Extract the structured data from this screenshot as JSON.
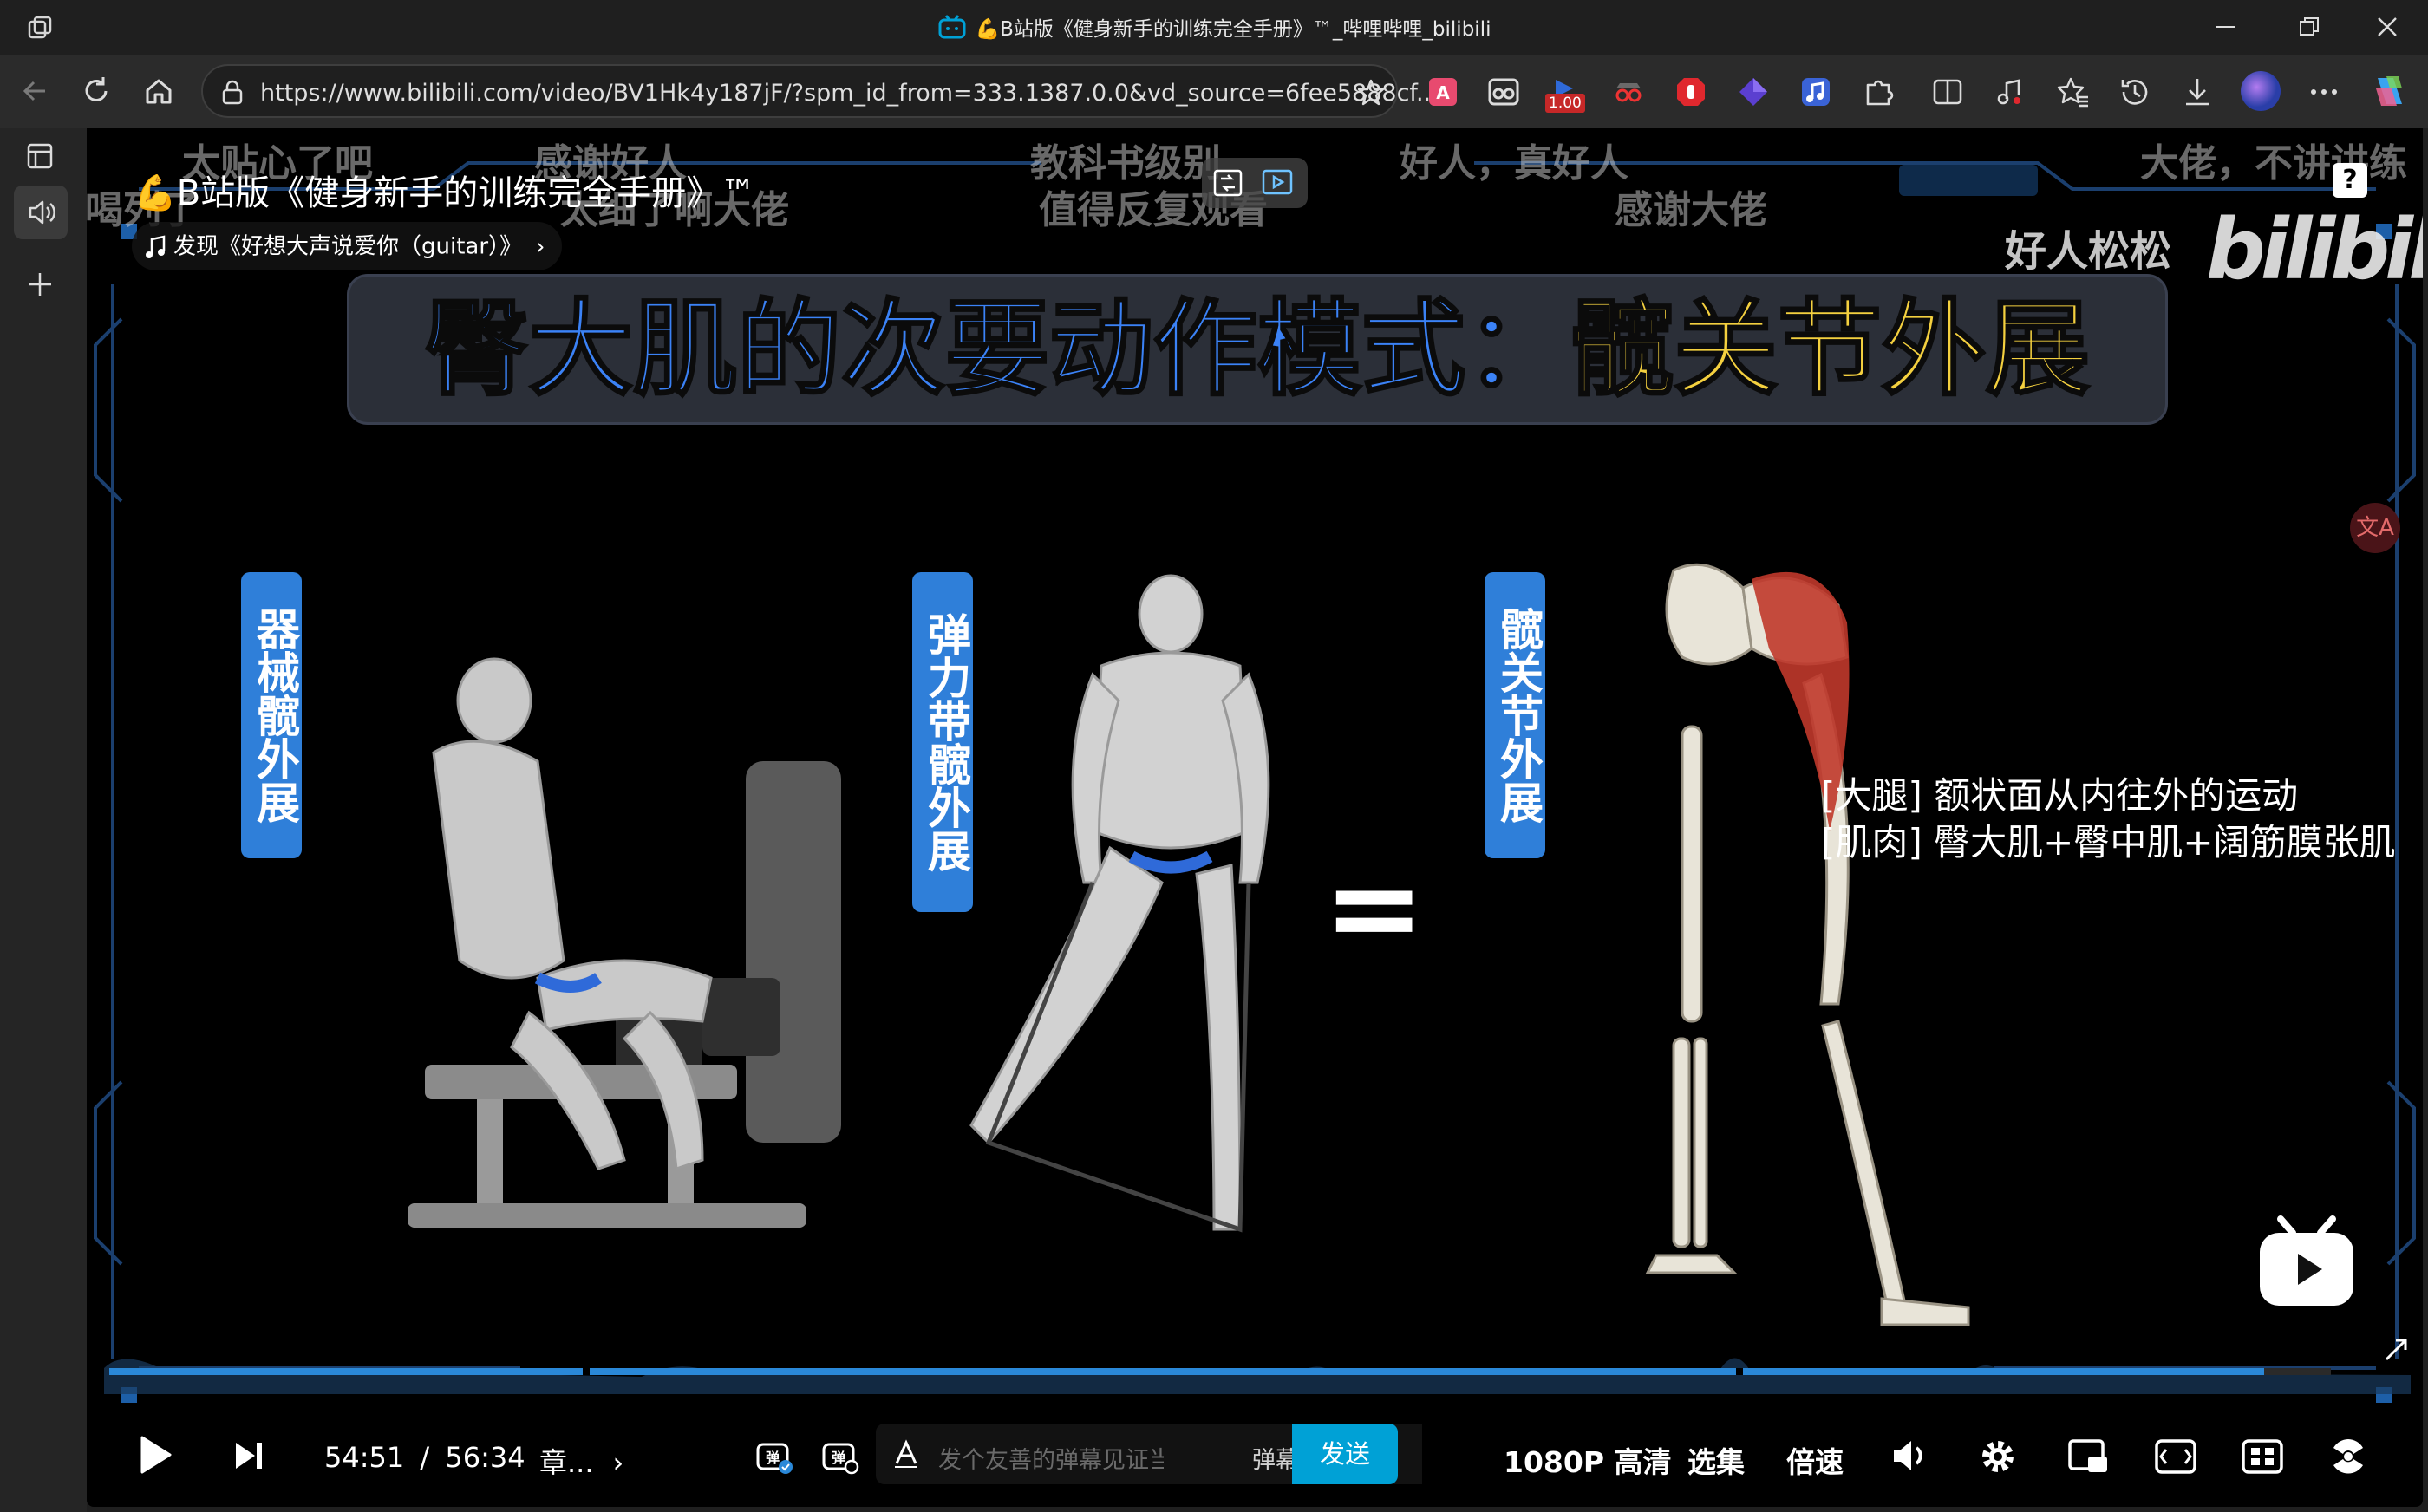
{
  "window": {
    "title": "💪B站版《健身新手的训练完全手册》™_哔哩哔哩_bilibili"
  },
  "browser": {
    "url": "https://www.bilibili.com/video/BV1Hk4y187jF/?spm_id_from=333.1387.0.0&vd_source=6fee5888cf...",
    "extension_badge": "1.00"
  },
  "video": {
    "overlay_title": "💪B站版《健身新手的训练完全手册》™",
    "music_tag": "发现《好想大声说爱你（guitar）》",
    "watermark_name": "好人松松",
    "watermark_logo": "bilibili",
    "help_badge": "?",
    "headline_blue": "臀大肌的次要动作模式：",
    "headline_yellow": "髋关节外展",
    "label_machine": "器械髋外展",
    "label_band": "弹力带髋外展",
    "label_joint": "髋关节外展",
    "equals": "=",
    "note_line1": "[大腿] 额状面从内往外的运动",
    "note_line2": "[肌肉] 臀大肌+臀中肌+阔筋膜张肌",
    "translate_badge": "文A",
    "danmaku": [
      "太贴心了吧",
      "感谢好人",
      "教科书级别",
      "好人，真好人",
      "大佬，不讲讲练",
      "喝列了",
      "太细了啊大佬",
      "值得反复观看",
      "感谢大佬"
    ]
  },
  "controls": {
    "current_time": "54:51",
    "separator": "/",
    "total_time": "56:34",
    "chapter": "章...",
    "danmaku_placeholder": "发个友善的弹幕见证当下",
    "danmaku_etiquette": "弹幕礼仪",
    "send": "发送",
    "quality": "1080P 高清",
    "episodes": "选集",
    "speed": "倍速",
    "progress": 0.97
  },
  "colors": {
    "accent_blue": "#00a1d6",
    "label_blue": "#2f7fd9",
    "headline_blue": "#3b82f6",
    "headline_yellow": "#f4d03f"
  }
}
